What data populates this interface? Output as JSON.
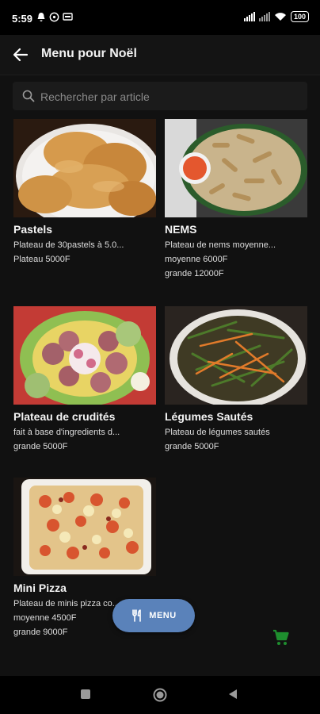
{
  "status_bar": {
    "time": "5:59",
    "battery": "100"
  },
  "app_bar": {
    "title": "Menu pour Noël"
  },
  "search": {
    "placeholder": "Rechercher par article"
  },
  "items": [
    {
      "name": "Pastels",
      "description": "Plateau de 30pastels à 5.0...",
      "prices": [
        "Plateau  5000F"
      ]
    },
    {
      "name": "NEMS",
      "description": "Plateau de nems moyenne...",
      "prices": [
        "moyenne  6000F",
        "grande  12000F"
      ]
    },
    {
      "name": "Plateau de crudités",
      "description": "fait à base d'ingredients d...",
      "prices": [
        "grande  5000F"
      ]
    },
    {
      "name": "Légumes Sautés",
      "description": "Plateau de légumes sautés",
      "prices": [
        "grande  5000F"
      ]
    },
    {
      "name": "Mini Pizza",
      "description": "Plateau de minis pizza co...",
      "prices": [
        "moyenne  4500F",
        "grande  9000F"
      ]
    }
  ],
  "fab": {
    "menu_label": "MENU"
  },
  "colors": {
    "background": "#111111",
    "fab": "#5a82ba",
    "cart": "#1e8e2e"
  },
  "icons": [
    "arrow-back-icon",
    "search-icon",
    "fork-knife-icon",
    "cart-icon",
    "square-icon",
    "circle-icon",
    "triangle-back-icon"
  ]
}
